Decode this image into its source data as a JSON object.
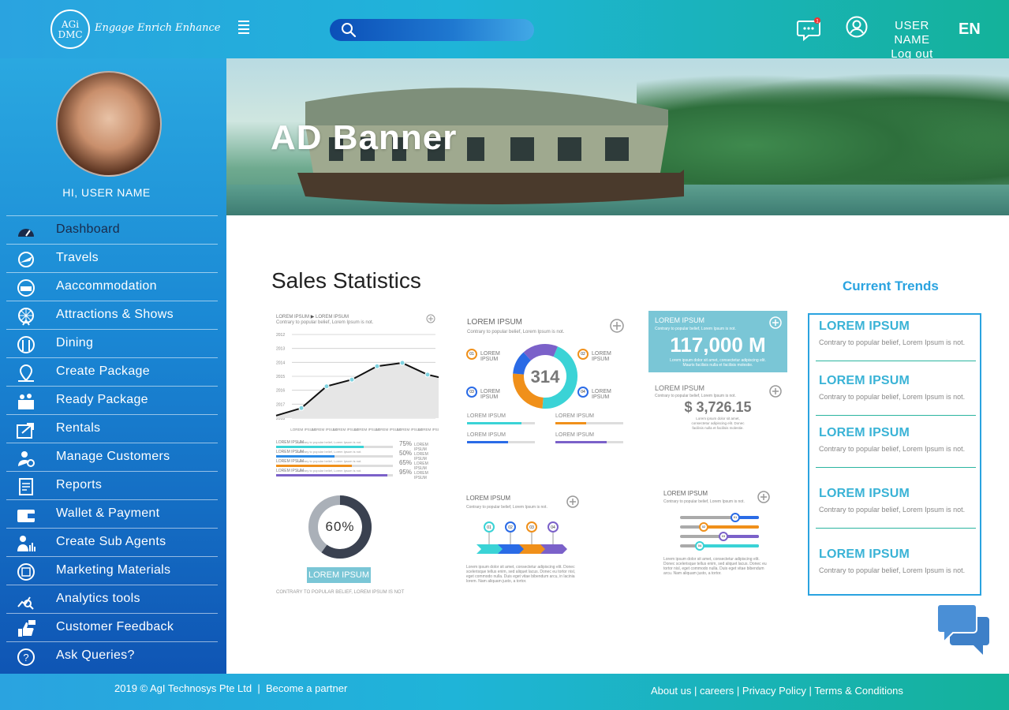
{
  "header": {
    "logo_line1": "AGi",
    "logo_line2": "DMC",
    "tagline": "Engage Enrich Enhance",
    "search_placeholder": "",
    "notification_count": "1",
    "user_name": "USER NAME",
    "logout": "Log out",
    "language": "EN"
  },
  "sidebar": {
    "greeting": "HI, USER NAME",
    "items": [
      {
        "label": "Dashboard",
        "icon": "speedometer-icon"
      },
      {
        "label": "Travels",
        "icon": "plane-globe-icon"
      },
      {
        "label": "Aaccommodation",
        "icon": "bed-icon"
      },
      {
        "label": "Attractions & Shows",
        "icon": "ferris-wheel-icon"
      },
      {
        "label": "Dining",
        "icon": "dining-icon"
      },
      {
        "label": "Create Package",
        "icon": "map-pin-icon"
      },
      {
        "label": "Ready Package",
        "icon": "gift-box-icon"
      },
      {
        "label": "Rentals",
        "icon": "share-icon"
      },
      {
        "label": "Manage Customers",
        "icon": "user-gear-icon"
      },
      {
        "label": "Reports",
        "icon": "report-icon"
      },
      {
        "label": "Wallet & Payment",
        "icon": "wallet-icon"
      },
      {
        "label": "Create Sub Agents",
        "icon": "agent-chart-icon"
      },
      {
        "label": "Marketing Materials",
        "icon": "marketing-icon"
      },
      {
        "label": "Analytics tools",
        "icon": "analytics-icon"
      },
      {
        "label": "Customer Feedback",
        "icon": "thumbs-up-icon"
      },
      {
        "label": "Ask Queries?",
        "icon": "question-icon"
      }
    ]
  },
  "banner": {
    "title": "AD Banner"
  },
  "main": {
    "sales_title": "Sales Statistics",
    "trends_title": "Current Trends"
  },
  "widgets": {
    "line_chart": {
      "title": "LOREM IPSUM",
      "legend": "LOREM IPSUM",
      "subtitle": "Contrary to popular belief, Lorem Ipsum is not.",
      "y_ticks": [
        "2012",
        "2013",
        "2014",
        "2015",
        "2016",
        "2017",
        "2018"
      ],
      "x_ticks": [
        "LOREM IPSUM",
        "LOREM IPSUM",
        "LOREM IPSUM",
        "LOREM IPSUM",
        "LOREM IPSUM",
        "LOREM IPSUM",
        "LOREM IPSUM"
      ],
      "bars": [
        {
          "label": "LOREM IPSUM",
          "text": "Contrary to popular belief, Lorem Ipsum is not.",
          "pct": "75%",
          "tag": "LOREM IPSUM",
          "color": "#3ad3d6",
          "fill": 0.75
        },
        {
          "label": "LOREM IPSUM",
          "text": "Contrary to popular belief, Lorem Ipsum is not.",
          "pct": "50%",
          "tag": "LOREM IPSUM",
          "color": "#2a8be6",
          "fill": 0.5
        },
        {
          "label": "LOREM IPSUM",
          "text": "Contrary to popular belief, Lorem Ipsum is not.",
          "pct": "65%",
          "tag": "LOREM IPSUM",
          "color": "#f0901a",
          "fill": 0.65
        },
        {
          "label": "LOREM IPSUM",
          "text": "Contrary to popular belief, Lorem Ipsum is not.",
          "pct": "95%",
          "tag": "LOREM IPSUM",
          "color": "#7b61c9",
          "fill": 0.95
        }
      ]
    },
    "donut_card": {
      "title": "LOREM IPSUM",
      "subtitle": "Contrary to popular belief, Lorem Ipsum is not.",
      "center": "314",
      "tags": [
        {
          "num": "01",
          "label": "LOREM IPSUM",
          "color": "#f0901a"
        },
        {
          "num": "02",
          "label": "LOREM IPSUM",
          "color": "#f0901a"
        },
        {
          "num": "03",
          "label": "LOREM IPSUM",
          "color": "#2a6be6"
        },
        {
          "num": "04",
          "label": "LOREM IPSUM",
          "color": "#2a6be6"
        }
      ],
      "bars": [
        {
          "label": "LOREM IPSUM",
          "color": "#3ad3d6",
          "fill": 0.8
        },
        {
          "label": "LOREM IPSUM",
          "color": "#f0901a",
          "fill": 0.45
        },
        {
          "label": "LOREM IPSUM",
          "color": "#2a6be6",
          "fill": 0.6
        },
        {
          "label": "LOREM IPSUM",
          "color": "#7b61c9",
          "fill": 0.75
        }
      ]
    },
    "big_number": {
      "title": "LOREM IPSUM",
      "subtitle": "Contrary to popular belief, Lorem Ipsum is not.",
      "value": "117,000 M",
      "note": "Lorem ipsum dolor sit amet, consectetur adipiscing elit. Mauris facilisis nulla et facilisis molestie."
    },
    "small_number": {
      "title": "LOREM IPSUM",
      "subtitle": "Contrary to popular belief, Lorem Ipsum is not.",
      "value": "$ 3,726.15",
      "note": "Lorem ipsum dolor sit amet, consectetur adipiscing elit. Donec facilisis nulla et facilisis molestie."
    },
    "ring": {
      "value": "60%",
      "fill": 0.6,
      "button": "LOREM IPSUM",
      "caption": "CONTRARY TO POPULAR BELIEF, LOREM IPSUM IS NOT"
    },
    "steps": {
      "title": "LOREM IPSUM",
      "subtitle": "Contrary to popular belief, Lorem Ipsum is not.",
      "nodes": [
        "01",
        "02",
        "03",
        "04"
      ],
      "colors": [
        "#3ad3d6",
        "#2a6be6",
        "#f0901a",
        "#7b61c9"
      ],
      "text": "Lorem ipsum dolor sit amet, consectetur adipiscing elit. Donec scelerisque tellus enim, sed aliquet lacus. Donec eu tortor nisl, eget commodo nulla. Duis eget vitae bibendum arcu, in lacinia lorem. Nam aliquam justo, a tortor."
    },
    "sliders": {
      "title": "LOREM IPSUM",
      "subtitle": "Contrary to popular belief, Lorem Ipsum is not.",
      "rows": [
        {
          "num": "01",
          "color": "#2a6be6",
          "fill": 0.7
        },
        {
          "num": "02",
          "color": "#f0901a",
          "fill": 0.3
        },
        {
          "num": "03",
          "color": "#7b61c9",
          "fill": 0.55
        },
        {
          "num": "04",
          "color": "#3ad3d6",
          "fill": 0.25
        }
      ],
      "text": "Lorem ipsum dolor sit amet, consectetur adipiscing elit. Donec scelerisque tellus enim, sed aliquet lacus. Donec eu tortor nisl, eget commodo nulla. Duis eget vitae bibendum arcu. Nam aliquam justo, a tortor."
    }
  },
  "trends": [
    {
      "title": "LOREM IPSUM",
      "text": "Contrary to popular belief, Lorem Ipsum is not."
    },
    {
      "title": "LOREM IPSUM",
      "text": "Contrary to popular belief, Lorem Ipsum is not."
    },
    {
      "title": "LOREM IPSUM",
      "text": "Contrary to popular belief, Lorem Ipsum is not."
    },
    {
      "title": "LOREM IPSUM",
      "text": "Contrary to popular belief, Lorem Ipsum is not."
    },
    {
      "title": "LOREM IPSUM",
      "text": "Contrary to popular belief, Lorem Ipsum is not."
    }
  ],
  "footer": {
    "copyright": "2019 © AgI Technosys Pte Ltd",
    "separator": "|",
    "partner": "Become a partner",
    "links": [
      "About us",
      "careers",
      "Privacy Policy",
      "Terms & Conditions"
    ]
  }
}
